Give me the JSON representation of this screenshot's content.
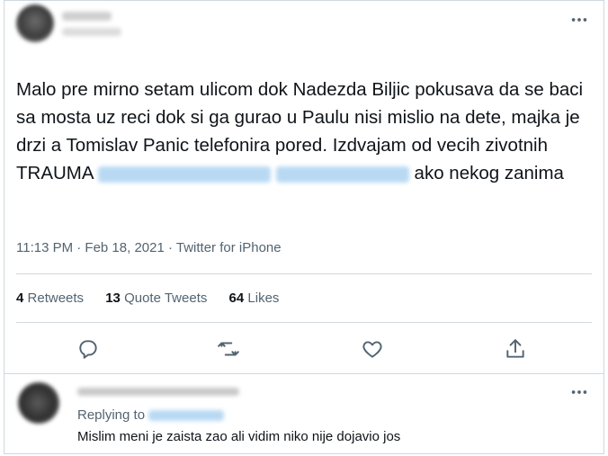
{
  "tweet": {
    "text_part1": "Malo pre mirno setam ulicom dok Nadezda Biljic pokusava da se baci sa mosta uz reci dok si ga gurao u Paulu nisi mislio na dete, majka je drzi a Tomislav Panic telefonira pored. Izdvajam od vecih zivotnih TRAUMA",
    "text_part2": " ako nekog zanima",
    "timestamp": "11:13 PM · Feb 18, 2021 · Twitter for iPhone",
    "retweets_count": "4",
    "retweets_label": "Retweets",
    "quotes_count": "13",
    "quotes_label": "Quote Tweets",
    "likes_count": "64",
    "likes_label": "Likes",
    "more_icon": "more-dots-icon"
  },
  "actions": [
    "reply-icon",
    "retweet-icon",
    "like-icon",
    "share-icon"
  ],
  "reply": {
    "replying_label": "Replying to",
    "text": "Mislim meni je zaista zao ali vidim niko nije dojavio jos"
  },
  "colors": {
    "text": "#0f1419",
    "secondary": "#536471",
    "divider": "#cfd9de",
    "mention": "#1d9bf0"
  }
}
